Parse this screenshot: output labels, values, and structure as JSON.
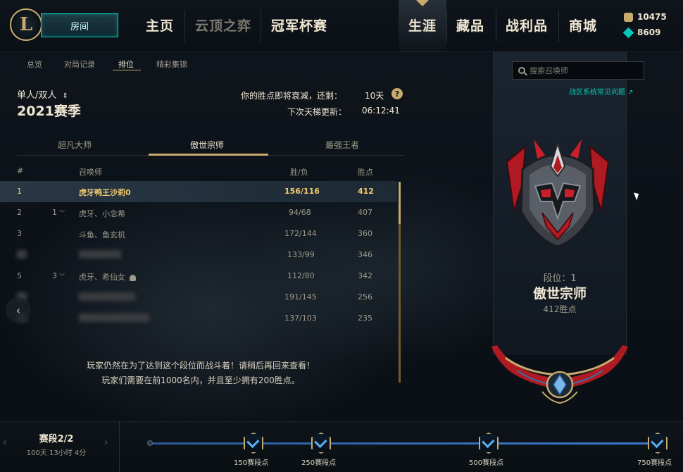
{
  "nav": {
    "play_button": "房间",
    "tabs": [
      "主页",
      "云顶之弈",
      "冠军杯赛",
      "生涯",
      "藏品",
      "战利品",
      "商城"
    ],
    "currency": {
      "rp": "10475",
      "be": "8609"
    }
  },
  "subnav": [
    "总览",
    "对局记录",
    "排位",
    "精彩集锦"
  ],
  "header": {
    "queue": "单人/双人",
    "season": "2021赛季",
    "decay_text": "你的胜点即将衰减，还剩：",
    "decay_value": "10天",
    "ladder_text": "下次天梯更新：",
    "ladder_value": "06:12:41"
  },
  "tier_tabs": [
    "超凡大师",
    "傲世宗师",
    "最强王者"
  ],
  "table": {
    "headers": [
      "#",
      "召唤师",
      "胜/负",
      "胜点"
    ],
    "rows": [
      {
        "rank": "1",
        "change": "",
        "name": "虎牙鸭王沙莉0",
        "record": "156/116",
        "lp": "412",
        "blurred": false,
        "highlight": true
      },
      {
        "rank": "2",
        "change": "1",
        "name": "虎牙、小念希",
        "record": "94/68",
        "lp": "407",
        "blurred": false,
        "highlight": false
      },
      {
        "rank": "3",
        "change": "",
        "name": "斗鱼、鱼玄机",
        "record": "172/144",
        "lp": "360",
        "blurred": false,
        "highlight": false
      },
      {
        "rank": "",
        "change": "",
        "name": "",
        "record": "133/99",
        "lp": "346",
        "blurred": true,
        "highlight": false
      },
      {
        "rank": "5",
        "change": "3",
        "name": "虎牙、希仙女",
        "record": "112/80",
        "lp": "342",
        "blurred": false,
        "highlight": false
      },
      {
        "rank": "",
        "change": "",
        "name": "",
        "record": "191/145",
        "lp": "256",
        "blurred": true,
        "highlight": false
      },
      {
        "rank": "",
        "change": "",
        "name": "",
        "record": "137/103",
        "lp": "235",
        "blurred": true,
        "highlight": false
      }
    ]
  },
  "footer_message": {
    "line1": "玩家仍然在为了达到这个段位而战斗着！请稍后再回来查看！",
    "line2": "玩家们需要在前1000名内，并且至少拥有200胜点。"
  },
  "right_panel": {
    "search_placeholder": "搜索召唤师",
    "faq_link": "战区系统常见问题 ↗",
    "rank_position": "段位：1",
    "rank_name": "傲世宗师",
    "rank_lp": "412胜点"
  },
  "season_progress": {
    "title": "赛段2/2",
    "time_left": "100天 13小时 4分",
    "milestones": [
      "150赛段点",
      "250赛段点",
      "500赛段点",
      "750赛段点"
    ]
  },
  "colors": {
    "gold": "#c8aa6e",
    "highlight_text": "#f0c86e",
    "teal": "#0ac8b9",
    "text_primary": "#f0e6d2",
    "text_secondary": "#a09b8c"
  },
  "icons": [
    "league-logo-icon",
    "rp-coin-icon",
    "blue-essence-icon",
    "help-icon",
    "search-icon",
    "chevron-left-icon",
    "person-icon",
    "milestone-check-icon",
    "grandmaster-emblem-icon"
  ]
}
